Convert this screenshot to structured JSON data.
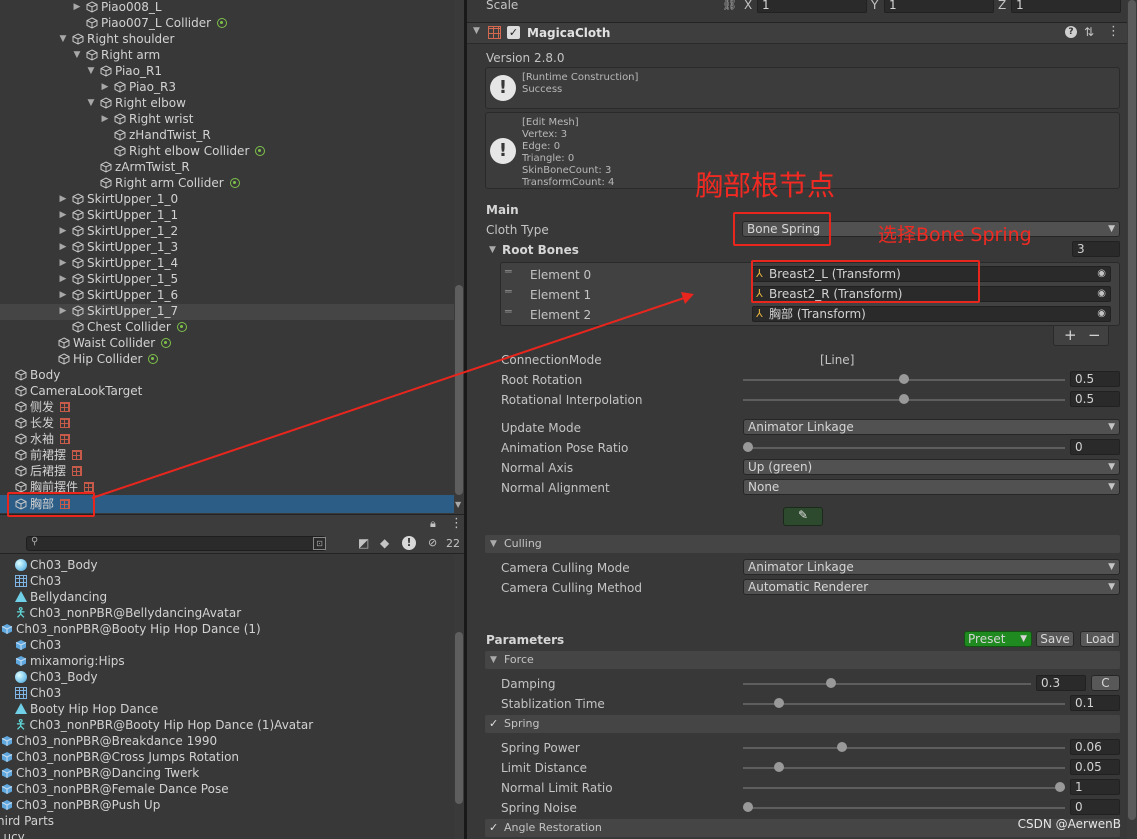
{
  "hierarchy": {
    "items": [
      {
        "label": "Piao008_L",
        "depth": 5,
        "arrow": "▶",
        "tag": ""
      },
      {
        "label": "Piao007_L Collider",
        "depth": 5,
        "arrow": "",
        "tag": "collider"
      },
      {
        "label": "Right shoulder",
        "depth": 4,
        "arrow": "▼",
        "tag": ""
      },
      {
        "label": "Right arm",
        "depth": 5,
        "arrow": "▼",
        "tag": ""
      },
      {
        "label": "Piao_R1",
        "depth": 6,
        "arrow": "▼",
        "tag": ""
      },
      {
        "label": "Piao_R3",
        "depth": 7,
        "arrow": "▶",
        "tag": ""
      },
      {
        "label": "Right elbow",
        "depth": 6,
        "arrow": "▼",
        "tag": ""
      },
      {
        "label": "Right wrist",
        "depth": 7,
        "arrow": "▶",
        "tag": ""
      },
      {
        "label": "zHandTwist_R",
        "depth": 7,
        "arrow": "",
        "tag": ""
      },
      {
        "label": "Right elbow Collider",
        "depth": 7,
        "arrow": "",
        "tag": "collider"
      },
      {
        "label": "zArmTwist_R",
        "depth": 6,
        "arrow": "",
        "tag": ""
      },
      {
        "label": "Right arm Collider",
        "depth": 6,
        "arrow": "",
        "tag": "collider"
      },
      {
        "label": "SkirtUpper_1_0",
        "depth": 4,
        "arrow": "▶",
        "tag": ""
      },
      {
        "label": "SkirtUpper_1_1",
        "depth": 4,
        "arrow": "▶",
        "tag": ""
      },
      {
        "label": "SkirtUpper_1_2",
        "depth": 4,
        "arrow": "▶",
        "tag": ""
      },
      {
        "label": "SkirtUpper_1_3",
        "depth": 4,
        "arrow": "▶",
        "tag": ""
      },
      {
        "label": "SkirtUpper_1_4",
        "depth": 4,
        "arrow": "▶",
        "tag": ""
      },
      {
        "label": "SkirtUpper_1_5",
        "depth": 4,
        "arrow": "▶",
        "tag": ""
      },
      {
        "label": "SkirtUpper_1_6",
        "depth": 4,
        "arrow": "▶",
        "tag": ""
      },
      {
        "label": "SkirtUpper_1_7",
        "depth": 4,
        "arrow": "▶",
        "tag": ""
      },
      {
        "label": "Chest Collider",
        "depth": 4,
        "arrow": "",
        "tag": "collider"
      },
      {
        "label": "Waist Collider",
        "depth": 3,
        "arrow": "",
        "tag": "collider"
      },
      {
        "label": "Hip Collider",
        "depth": 3,
        "arrow": "",
        "tag": "collider"
      },
      {
        "label": "Body",
        "depth": 0,
        "arrow": "",
        "tag": ""
      },
      {
        "label": "CameraLookTarget",
        "depth": 0,
        "arrow": "",
        "tag": ""
      },
      {
        "label": "侧发",
        "depth": 0,
        "arrow": "",
        "tag": "cloth"
      },
      {
        "label": "长发",
        "depth": 0,
        "arrow": "",
        "tag": "cloth"
      },
      {
        "label": "水袖",
        "depth": 0,
        "arrow": "",
        "tag": "cloth"
      },
      {
        "label": "前裙摆",
        "depth": 0,
        "arrow": "",
        "tag": "cloth"
      },
      {
        "label": "后裙摆",
        "depth": 0,
        "arrow": "",
        "tag": "cloth"
      },
      {
        "label": "胸前摆件",
        "depth": 0,
        "arrow": "",
        "tag": "cloth"
      },
      {
        "label": "胸部",
        "depth": 0,
        "arrow": "",
        "tag": "cloth"
      }
    ]
  },
  "project": {
    "search_count": "22",
    "items": [
      {
        "label": "Ch03_Body",
        "indent": 1,
        "icon": "material"
      },
      {
        "label": "Ch03",
        "indent": 1,
        "icon": "mesh"
      },
      {
        "label": "Bellydancing",
        "indent": 1,
        "icon": "anim"
      },
      {
        "label": "Ch03_nonPBR@BellydancingAvatar",
        "indent": 1,
        "icon": "avatar"
      },
      {
        "label": "Ch03_nonPBR@Booty Hip Hop Dance (1)",
        "indent": 0,
        "icon": "model"
      },
      {
        "label": "Ch03",
        "indent": 1,
        "icon": "model"
      },
      {
        "label": "mixamorig:Hips",
        "indent": 1,
        "icon": "model"
      },
      {
        "label": "Ch03_Body",
        "indent": 1,
        "icon": "material"
      },
      {
        "label": "Ch03",
        "indent": 1,
        "icon": "mesh"
      },
      {
        "label": "Booty Hip Hop Dance",
        "indent": 1,
        "icon": "anim"
      },
      {
        "label": "Ch03_nonPBR@Booty Hip Hop Dance (1)Avatar",
        "indent": 1,
        "icon": "avatar"
      },
      {
        "label": "Ch03_nonPBR@Breakdance 1990",
        "indent": 0,
        "icon": "model"
      },
      {
        "label": "Ch03_nonPBR@Cross Jumps Rotation",
        "indent": 0,
        "icon": "model"
      },
      {
        "label": "Ch03_nonPBR@Dancing Twerk",
        "indent": 0,
        "icon": "model"
      },
      {
        "label": "Ch03_nonPBR@Female Dance Pose",
        "indent": 0,
        "icon": "model"
      },
      {
        "label": "Ch03_nonPBR@Push Up",
        "indent": 0,
        "icon": "model"
      },
      {
        "label": "hird Parts",
        "indent": -1,
        "icon": ""
      },
      {
        "label": "Lucy",
        "indent": -1,
        "icon": ""
      }
    ]
  },
  "inspector": {
    "scale": {
      "label": "Scale",
      "x_label": "X",
      "x": "1",
      "y_label": "Y",
      "y": "1",
      "z_label": "Z",
      "z": "1"
    },
    "component_title": "MagicaCloth",
    "version": "Version 2.8.0",
    "runtime_box": [
      "[Runtime Construction]",
      "Success"
    ],
    "editmesh_box": [
      "[Edit Mesh]",
      "Vertex: 3",
      "Edge: 0",
      "Triangle: 0",
      "SkinBoneCount: 3",
      "TransformCount: 4"
    ],
    "main_label": "Main",
    "cloth_type_label": "Cloth Type",
    "cloth_type_value": "Bone Spring",
    "root_bones_label": "Root Bones",
    "root_bones_count": "3",
    "elements": [
      {
        "label": "Element 0",
        "value": "Breast2_L (Transform)"
      },
      {
        "label": "Element 1",
        "value": "Breast2_R (Transform)"
      },
      {
        "label": "Element 2",
        "value": "胸部 (Transform)"
      }
    ],
    "plus": "+",
    "minus": "−",
    "connection_mode_label": "ConnectionMode",
    "connection_mode_value": "[Line]",
    "root_rotation_label": "Root Rotation",
    "root_rotation_value": "0.5",
    "rot_interp_label": "Rotational Interpolation",
    "rot_interp_value": "0.5",
    "update_mode_label": "Update Mode",
    "update_mode_value": "Animator Linkage",
    "anim_pose_label": "Animation Pose Ratio",
    "anim_pose_value": "0",
    "normal_axis_label": "Normal Axis",
    "normal_axis_value": "Up (green)",
    "normal_align_label": "Normal Alignment",
    "normal_align_value": "None",
    "culling_header": "Culling",
    "camera_mode_label": "Camera Culling Mode",
    "camera_mode_value": "Animator Linkage",
    "camera_method_label": "Camera Culling Method",
    "camera_method_value": "Automatic Renderer",
    "parameters_label": "Parameters",
    "preset_label": "Preset",
    "save_label": "Save",
    "load_label": "Load",
    "force_header": "Force",
    "damping_label": "Damping",
    "damping_value": "0.3",
    "c_label": "C",
    "stab_label": "Stablization Time",
    "stab_value": "0.1",
    "spring_header": "Spring",
    "spring_power_label": "Spring Power",
    "spring_power_value": "0.06",
    "limit_dist_label": "Limit Distance",
    "limit_dist_value": "0.05",
    "normal_limit_label": "Normal Limit Ratio",
    "normal_limit_value": "1",
    "spring_noise_label": "Spring Noise",
    "spring_noise_value": "0",
    "angle_header": "Angle Restoration"
  },
  "sliders": {
    "root_rotation": 0.5,
    "rot_interp": 0.5,
    "anim_pose": 0.0,
    "damping": 0.3,
    "stab": 0.1,
    "spring_power": 0.3,
    "limit_dist": 0.1,
    "normal_limit": 1.0,
    "spring_noise": 0.0
  },
  "annotations": {
    "root_node": "胸部根节点",
    "choose": "选择Bone Spring"
  },
  "watermark": "CSDN @AerwenB",
  "colors": {
    "selection": "#2c5d87",
    "accent_red": "#e8261e",
    "collider_green": "#7ec24a",
    "prefab_red": "#c85a4a",
    "preset_green": "#1f8a1f"
  }
}
